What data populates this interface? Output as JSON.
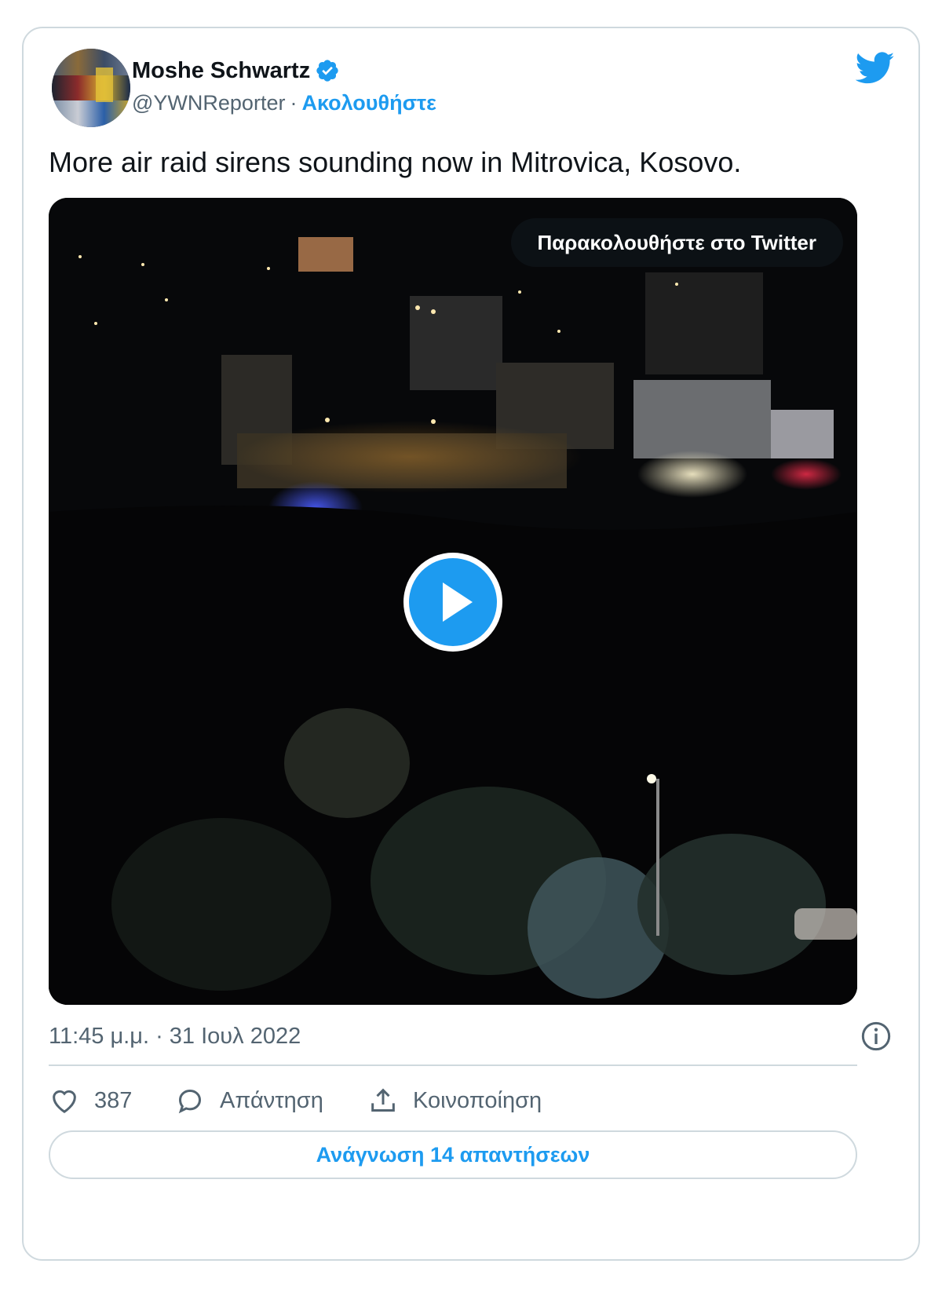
{
  "tweet": {
    "author_name": "Moshe Schwartz",
    "handle": "@YWNReporter",
    "separator": "·",
    "follow_label": "Ακολουθήστε",
    "verified": true,
    "text": "More air raid sirens sounding now in Mitrovica, Kosovo.",
    "timestamp": "11:45 μ.μ. · 31 Ιουλ 2022"
  },
  "media": {
    "type": "video",
    "watch_label": "Παρακολουθήστε στο Twitter"
  },
  "actions": {
    "like_count": "387",
    "reply_label": "Απάντηση",
    "share_label": "Κοινοποίηση"
  },
  "footer": {
    "read_replies_label": "Ανάγνωση 14 απαντήσεων"
  },
  "colors": {
    "accent": "#1d9bf0",
    "text_primary": "#0f1419",
    "text_secondary": "#536471",
    "border": "#cfd9de"
  },
  "icons": [
    "twitter-bird-icon",
    "verified-badge-icon",
    "play-icon",
    "info-icon",
    "heart-icon",
    "reply-icon",
    "share-icon"
  ]
}
